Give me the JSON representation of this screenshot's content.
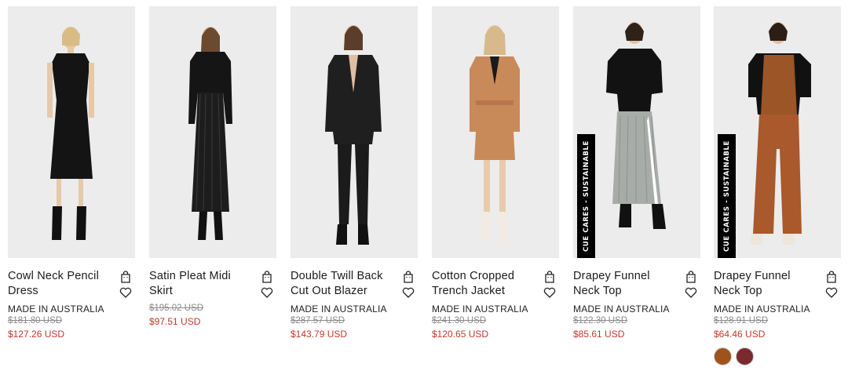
{
  "products": [
    {
      "name": "Cowl Neck Pencil Dress",
      "origin": "MADE IN AUSTRALIA",
      "was": "$181.80 USD",
      "now": "$127.26 USD",
      "badge": ""
    },
    {
      "name": "Satin Pleat Midi Skirt",
      "origin": "",
      "was": "$195.02 USD",
      "now": "$97.51 USD",
      "badge": ""
    },
    {
      "name": "Double Twill Back Cut Out Blazer",
      "origin": "MADE IN AUSTRALIA",
      "was": "$287.57 USD",
      "now": "$143.79 USD",
      "badge": ""
    },
    {
      "name": "Cotton Cropped Trench Jacket",
      "origin": "MADE IN AUSTRALIA",
      "was": "$241.30 USD",
      "now": "$120.65 USD",
      "badge": ""
    },
    {
      "name": "Drapey Funnel Neck Top",
      "origin": "MADE IN AUSTRALIA",
      "was": "$122.30 USD",
      "now": "$85.61 USD",
      "badge": "CUE CARES - SUSTAINABLE"
    },
    {
      "name": "Drapey Funnel Neck Top",
      "origin": "MADE IN AUSTRALIA",
      "was": "$128.91 USD",
      "now": "$64.46 USD",
      "badge": "CUE CARES - SUSTAINABLE",
      "swatches": [
        "#a0521c",
        "#7a2a2e"
      ]
    }
  ],
  "colors": {
    "sale": "#c0392b",
    "was": "#8a8a8a",
    "photo_bg": "#ececec"
  },
  "icons": {
    "bag": "shopping-bag-icon",
    "wishlist": "heart-icon"
  }
}
